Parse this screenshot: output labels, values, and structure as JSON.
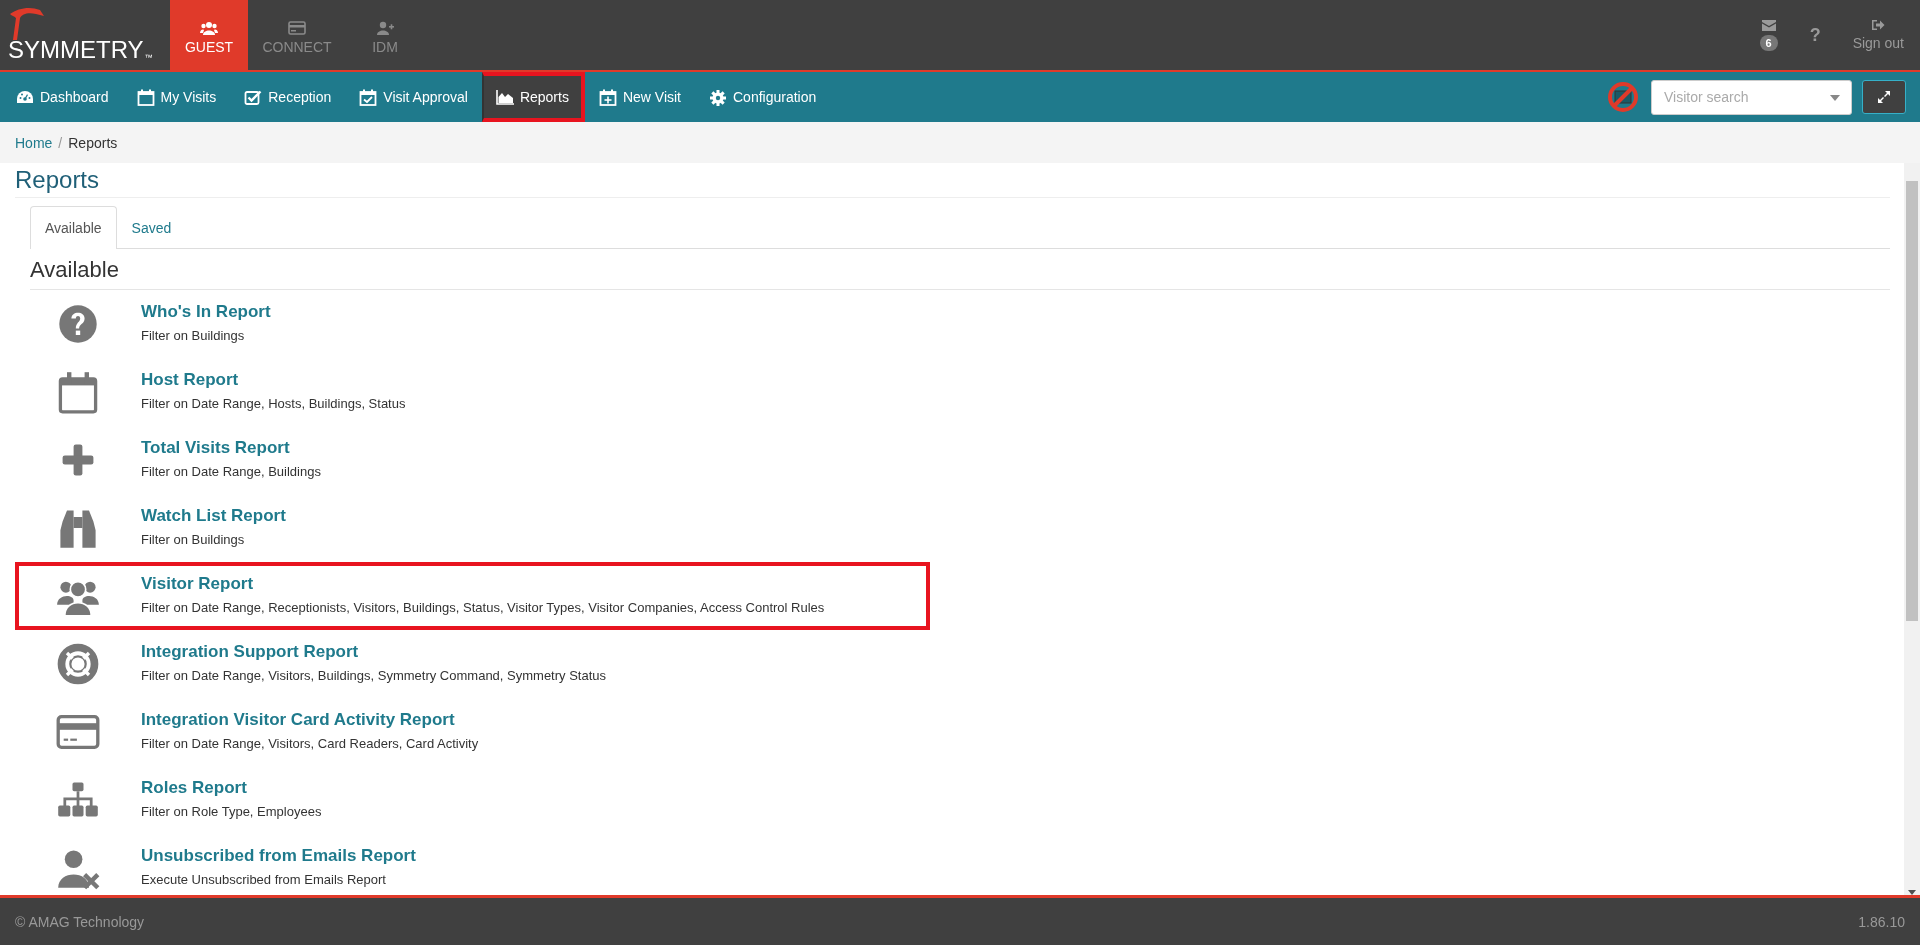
{
  "brand": {
    "logo": "SYMMETRY",
    "trademark": "™"
  },
  "apps": [
    {
      "label": "GUEST",
      "selected": true
    },
    {
      "label": "CONNECT",
      "selected": false
    },
    {
      "label": "IDM",
      "selected": false
    }
  ],
  "header_actions": {
    "mail_count": "6",
    "help": "?",
    "sign_out": "Sign out"
  },
  "nav": [
    {
      "label": "Dashboard",
      "selected": false
    },
    {
      "label": "My Visits",
      "selected": false
    },
    {
      "label": "Reception",
      "selected": false
    },
    {
      "label": "Visit Approval",
      "selected": false
    },
    {
      "label": "Reports",
      "selected": true
    },
    {
      "label": "New Visit",
      "selected": false
    },
    {
      "label": "Configuration",
      "selected": false
    }
  ],
  "search": {
    "placeholder": "Visitor search"
  },
  "breadcrumb": [
    "Home",
    "Reports"
  ],
  "breadcrumb_separator": "/",
  "page_title": "Reports",
  "tabs": [
    {
      "label": "Available",
      "selected": true
    },
    {
      "label": "Saved",
      "selected": false
    }
  ],
  "section_title": "Available",
  "reports": [
    {
      "title": "Who's In Report",
      "description": "Filter on Buildings",
      "highlighted": false
    },
    {
      "title": "Host Report",
      "description": "Filter on Date Range, Hosts, Buildings, Status",
      "highlighted": false
    },
    {
      "title": "Total Visits Report",
      "description": "Filter on Date Range, Buildings",
      "highlighted": false
    },
    {
      "title": "Watch List Report",
      "description": "Filter on Buildings",
      "highlighted": false
    },
    {
      "title": "Visitor Report",
      "description": "Filter on Date Range, Receptionists, Visitors, Buildings, Status, Visitor Types, Visitor Companies, Access Control Rules",
      "highlighted": true
    },
    {
      "title": "Integration Support Report",
      "description": "Filter on Date Range, Visitors, Buildings, Symmetry Command, Symmetry Status",
      "highlighted": false
    },
    {
      "title": "Integration Visitor Card Activity Report",
      "description": "Filter on Date Range, Visitors, Card Readers, Card Activity",
      "highlighted": false
    },
    {
      "title": "Roles Report",
      "description": "Filter on Role Type, Employees",
      "highlighted": false
    },
    {
      "title": "Unsubscribed from Emails Report",
      "description": "Execute Unsubscribed from Emails Report",
      "highlighted": false
    }
  ],
  "footer": {
    "copyright": "© AMAG Technology",
    "version": "1.86.10"
  }
}
